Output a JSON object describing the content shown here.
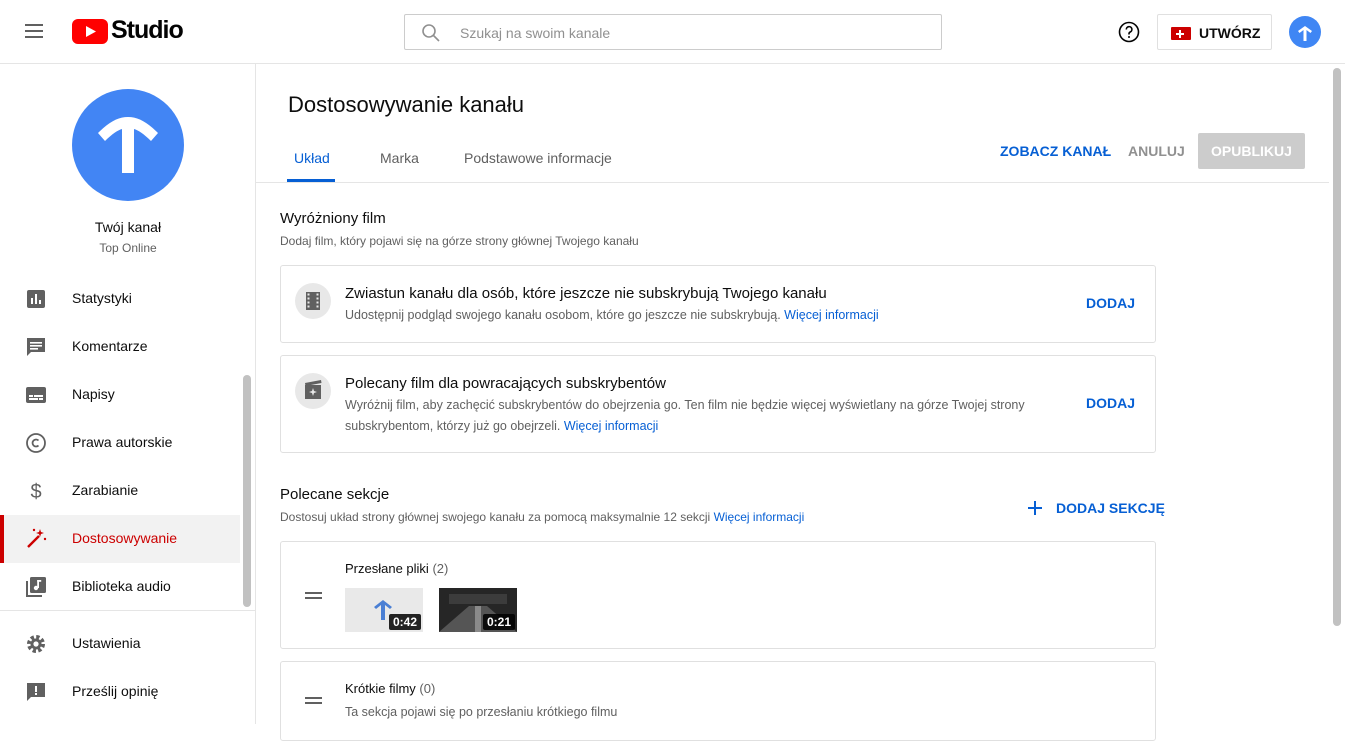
{
  "header": {
    "brand": "Studio",
    "search_placeholder": "Szukaj na swoim kanale",
    "create_label": "UTWÓRZ"
  },
  "sidebar": {
    "channel_name": "Twój kanał",
    "channel_subtitle": "Top Online",
    "items": [
      {
        "label": "Statystyki",
        "icon": "bar-chart-icon"
      },
      {
        "label": "Komentarze",
        "icon": "comment-icon"
      },
      {
        "label": "Napisy",
        "icon": "subtitles-icon"
      },
      {
        "label": "Prawa autorskie",
        "icon": "copyright-icon"
      },
      {
        "label": "Zarabianie",
        "icon": "dollar-icon"
      },
      {
        "label": "Dostosowywanie",
        "icon": "magic-wand-icon",
        "active": true
      },
      {
        "label": "Biblioteka audio",
        "icon": "audio-library-icon"
      },
      {
        "label": "Ustawienia",
        "icon": "gear-icon"
      },
      {
        "label": "Prześlij opinię",
        "icon": "feedback-icon"
      }
    ]
  },
  "main": {
    "title": "Dostosowywanie kanału",
    "tabs": [
      {
        "label": "Układ",
        "active": true
      },
      {
        "label": "Marka"
      },
      {
        "label": "Podstawowe informacje"
      }
    ],
    "actions": {
      "view_channel": "ZOBACZ KANAŁ",
      "cancel": "ANULUJ",
      "publish": "OPUBLIKUJ"
    },
    "featured": {
      "title": "Wyróżniony film",
      "desc": "Dodaj film, który pojawi się na górze strony głównej Twojego kanału",
      "cards": [
        {
          "title": "Zwiastun kanału dla osób, które jeszcze nie subskrybują Twojego kanału",
          "desc": "Udostępnij podgląd swojego kanału osobom, które go jeszcze nie subskrybują.",
          "link": "Więcej informacji",
          "action": "DODAJ"
        },
        {
          "title": "Polecany film dla powracających subskrybentów",
          "desc_line1": "Wyróżnij film, aby zachęcić subskrybentów do obejrzenia go. Ten film nie będzie więcej wyświetlany na górze Twojej strony",
          "desc_line2": "subskrybentom, którzy już go obejrzeli.",
          "link": "Więcej informacji",
          "action": "DODAJ"
        }
      ]
    },
    "sections": {
      "title": "Polecane sekcje",
      "desc": "Dostosuj układ strony głównej swojego kanału za pomocą maksymalnie 12 sekcji",
      "link": "Więcej informacji",
      "add_label": "DODAJ SEKCJĘ",
      "items": [
        {
          "name": "Przesłane pliki",
          "count": "(2)",
          "thumbs": [
            "0:42",
            "0:21"
          ]
        },
        {
          "name": "Krótkie filmy",
          "count": "(0)",
          "note": "Ta sekcja pojawi się po przesłaniu krótkiego filmu"
        }
      ]
    }
  },
  "colors": {
    "accent_blue": "#065fd4",
    "brand_red": "#cc0000",
    "avatar_blue": "#4285f4"
  }
}
